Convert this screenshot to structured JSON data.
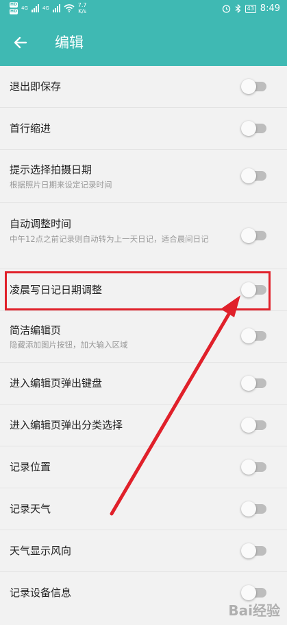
{
  "status_bar": {
    "hd1": "HD",
    "hd2": "HD",
    "net1": "4G",
    "net2": "4G",
    "speed_value": "7.7",
    "speed_unit": "K/s",
    "battery": "43",
    "time": "8:49"
  },
  "app_bar": {
    "title": "编辑"
  },
  "settings": [
    {
      "label": "退出即保存",
      "desc": "",
      "on": false
    },
    {
      "label": "首行缩进",
      "desc": "",
      "on": false
    },
    {
      "label": "提示选择拍摄日期",
      "desc": "根据照片日期来设定记录时间",
      "on": false
    },
    {
      "label": "自动调整时间",
      "desc": "中午12点之前记录则自动转为上一天日记，适合晨间日记",
      "on": false
    },
    {
      "label": "凌晨写日记日期调整",
      "desc": "",
      "on": false
    },
    {
      "label": "简洁编辑页",
      "desc": "隐藏添加图片按钮，加大输入区域",
      "on": false
    },
    {
      "label": "进入编辑页弹出键盘",
      "desc": "",
      "on": false
    },
    {
      "label": "进入编辑页弹出分类选择",
      "desc": "",
      "on": false
    },
    {
      "label": "记录位置",
      "desc": "",
      "on": false
    },
    {
      "label": "记录天气",
      "desc": "",
      "on": false
    },
    {
      "label": "天气显示风向",
      "desc": "",
      "on": false
    },
    {
      "label": "记录设备信息",
      "desc": "",
      "on": false
    }
  ],
  "watermark": "Bai经验",
  "colors": {
    "primary": "#3fb9b3",
    "highlight": "#e0202a",
    "toggle_track": "#bdbdbd"
  }
}
